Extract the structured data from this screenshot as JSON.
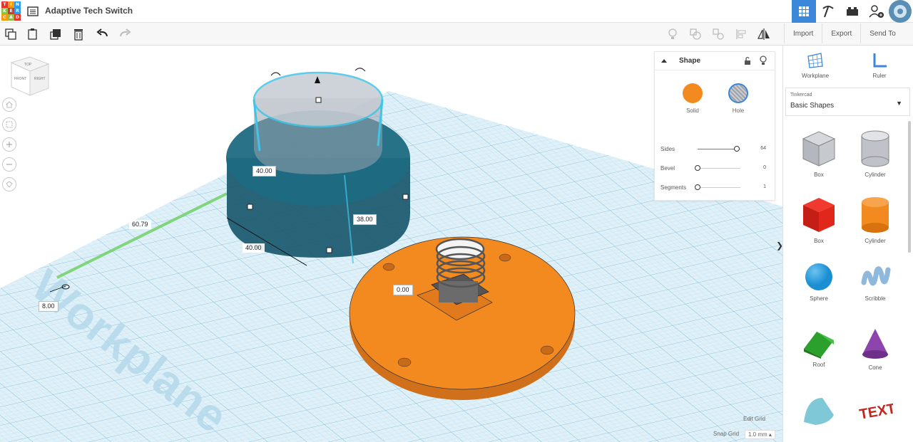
{
  "app": {
    "logo_letters": [
      "T",
      "I",
      "N",
      "K",
      "E",
      "R",
      "C",
      "A",
      "D"
    ],
    "logo_colors": [
      "#e6332a",
      "#f39c12",
      "#2b9de8",
      "#8bc34a",
      "#e6332a",
      "#2b9de8",
      "#f39c12",
      "#8bc34a",
      "#e6332a"
    ],
    "title": "Adaptive Tech Switch",
    "menu_icon": "list-icon",
    "accent": "#3b87d9"
  },
  "topbar": {
    "buttons": [
      {
        "name": "3d-design-view",
        "icon": "grid-icon",
        "active": true
      },
      {
        "name": "blocks-view",
        "icon": "pickaxe-icon",
        "active": false
      },
      {
        "name": "bricks-view",
        "icon": "brick-icon",
        "active": false
      },
      {
        "name": "invite-user",
        "icon": "add-user-icon",
        "active": false
      }
    ]
  },
  "toolbar": {
    "left_tools": [
      "copy-icon",
      "paste-icon",
      "duplicate-icon",
      "delete-icon",
      "undo-icon",
      "redo-icon"
    ],
    "right_tools": [
      "light-bulb-icon",
      "group-icon",
      "ungroup-icon",
      "align-icon",
      "mirror-icon"
    ],
    "import_label": "Import",
    "export_label": "Export",
    "send_to_label": "Send To"
  },
  "viewport": {
    "workplane_text": "Workplane",
    "dimensions": {
      "width_top": "40.00",
      "height": "38.00",
      "depth": "40.00",
      "distance": "60.79",
      "elevation": "8.00",
      "offset": "0.00"
    },
    "navcube": {
      "top": "TOP",
      "front": "FRONT",
      "right": "RIGHT"
    },
    "nav_buttons": [
      "home-icon",
      "fit-icon",
      "zoom-in-icon",
      "zoom-out-icon",
      "perspective-icon"
    ]
  },
  "inspector": {
    "title": "Shape",
    "solid_label": "Solid",
    "hole_label": "Hole",
    "solid_color": "#f28a1f",
    "sliders": [
      {
        "label": "Sides",
        "value": "64",
        "level": 0.95
      },
      {
        "label": "Bevel",
        "value": "0",
        "level": 0
      },
      {
        "label": "Segments",
        "value": "1",
        "level": 0
      }
    ]
  },
  "sidebar": {
    "workplane_label": "Workplane",
    "ruler_label": "Ruler",
    "library_small": "Tinkercad",
    "library_selected": "Basic Shapes",
    "shapes": [
      {
        "name": "Box",
        "kind": "box-hole"
      },
      {
        "name": "Cylinder",
        "kind": "cylinder-hole"
      },
      {
        "name": "Box",
        "kind": "box"
      },
      {
        "name": "Cylinder",
        "kind": "cylinder"
      },
      {
        "name": "Sphere",
        "kind": "sphere"
      },
      {
        "name": "Scribble",
        "kind": "scribble"
      },
      {
        "name": "Roof",
        "kind": "roof"
      },
      {
        "name": "Cone",
        "kind": "cone"
      },
      {
        "name": "",
        "kind": "round-roof"
      },
      {
        "name": "",
        "kind": "text"
      }
    ],
    "shape_colors": {
      "box": "#e1261c",
      "cylinder": "#f28a1f",
      "sphere": "#1b8fd2",
      "scribble": "#8fb9dc",
      "roof": "#2ca02c",
      "cone": "#8e44ad",
      "round-roof": "#7ec8d8",
      "text": "#c0271d",
      "hole": "#b9bcc2"
    }
  },
  "grid": {
    "edit_grid_label": "Edit Grid",
    "snap_grid_label": "Snap Grid",
    "snap_grid_value": "1.0 mm"
  }
}
